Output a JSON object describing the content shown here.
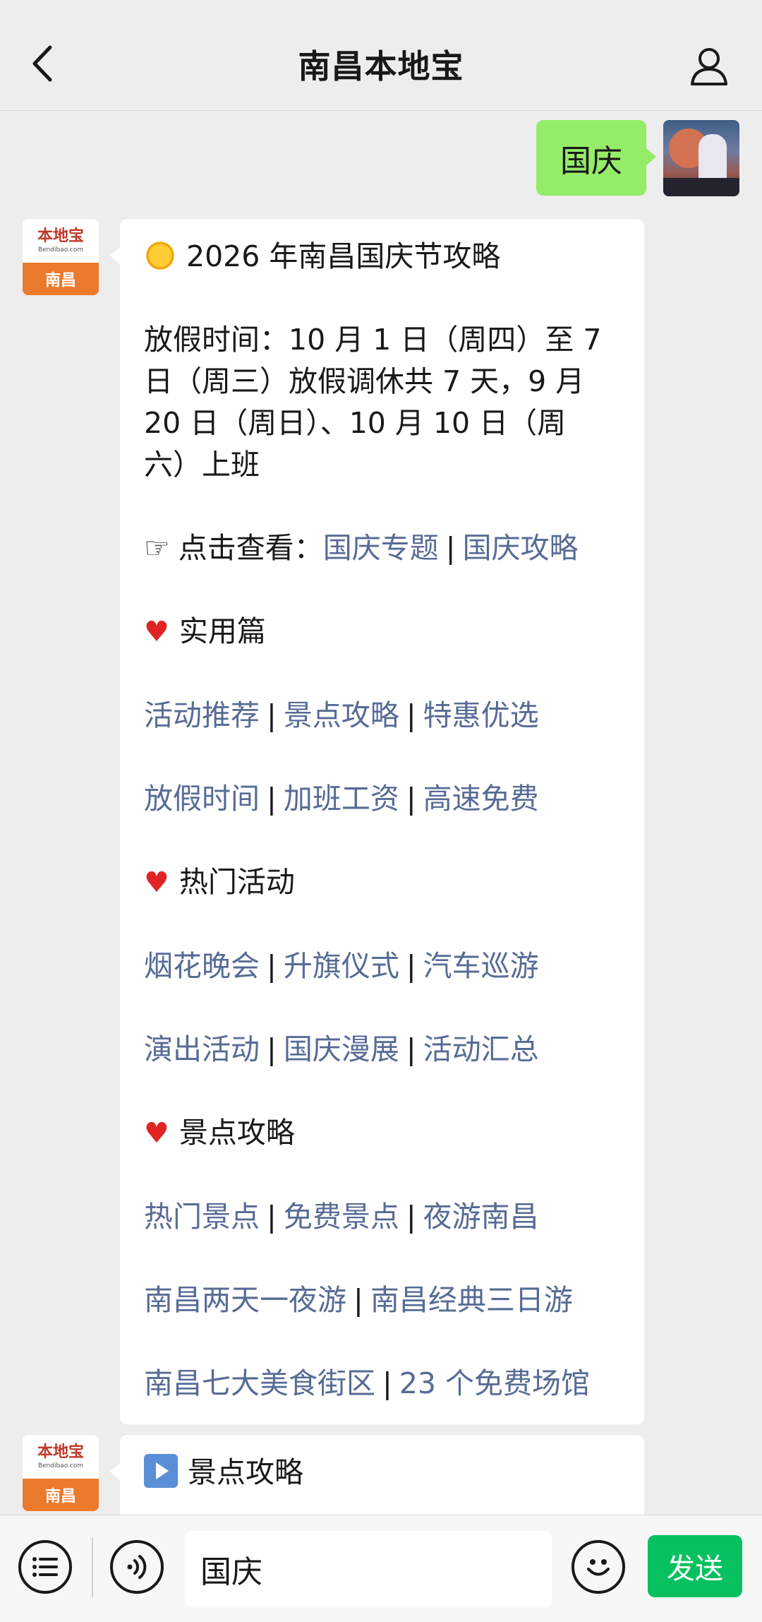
{
  "header": {
    "title": "南昌本地宝"
  },
  "outgoing": {
    "text": "国庆"
  },
  "bot": {
    "logo_main": "本地宝",
    "logo_sub": "Bendibao.com",
    "logo_city": "南昌"
  },
  "message1": {
    "title": "2026 年南昌国庆节攻略",
    "holiday_lines": [
      "放假时间：10 月 1 日（周四）至 7",
      "日（周三）放假调休共 7 天，9 月",
      "20 日（周日）、10 月 10 日（周",
      "六）上班"
    ],
    "click_prefix": "点击查看：",
    "pointer": "☞",
    "click_links": [
      "国庆专题",
      "国庆攻略"
    ],
    "sections": [
      {
        "heading": "实用篇",
        "rows": [
          [
            "活动推荐",
            "景点攻略",
            "特惠优选"
          ],
          [
            "放假时间",
            "加班工资",
            "高速免费"
          ]
        ]
      },
      {
        "heading": "热门活动",
        "rows": [
          [
            "烟花晚会",
            "升旗仪式",
            "汽车巡游"
          ],
          [
            "演出活动",
            "国庆漫展",
            "活动汇总"
          ]
        ]
      },
      {
        "heading": "景点攻略",
        "rows": [
          [
            "热门景点",
            "免费景点",
            "夜游南昌"
          ],
          [
            "南昌两天一夜游",
            "南昌经典三日游"
          ],
          [
            "南昌七大美食街区",
            "23 个免费场馆"
          ]
        ]
      }
    ],
    "separator": "|"
  },
  "message2": {
    "title": "景点攻略"
  },
  "input_bar": {
    "value": "国庆",
    "send_label": "发送"
  }
}
